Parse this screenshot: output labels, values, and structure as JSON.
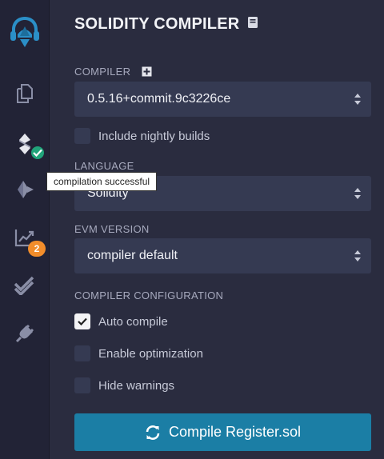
{
  "tooltip": "compilation successful",
  "iconbar": {
    "badge_count": "2",
    "items": [
      {
        "icon": "remix-logo-icon"
      },
      {
        "icon": "file-explorer-icon"
      },
      {
        "icon": "solidity-compiler-icon"
      },
      {
        "icon": "deploy-run-icon"
      },
      {
        "icon": "analysis-icon"
      },
      {
        "icon": "test-icon"
      },
      {
        "icon": "plugin-manager-icon"
      }
    ]
  },
  "panel": {
    "title": "SOLIDITY COMPILER",
    "compiler_label": "COMPILER",
    "compiler_value": "0.5.16+commit.9c3226ce",
    "nightly_label": "Include nightly builds",
    "language_label": "LANGUAGE",
    "language_value": "Solidity",
    "evm_label": "EVM VERSION",
    "evm_value": "compiler default",
    "config_label": "COMPILER CONFIGURATION",
    "options": [
      {
        "label": "Auto compile",
        "checked": true
      },
      {
        "label": "Enable optimization",
        "checked": false
      },
      {
        "label": "Hide warnings",
        "checked": false
      }
    ],
    "compile_button": "Compile Register.sol"
  },
  "colors": {
    "background": "#2a2c3f",
    "iconbar": "#222336",
    "input": "#353a52",
    "accent_button": "#1b7ea5",
    "success": "#21a47a",
    "warning": "#f28d2b"
  }
}
